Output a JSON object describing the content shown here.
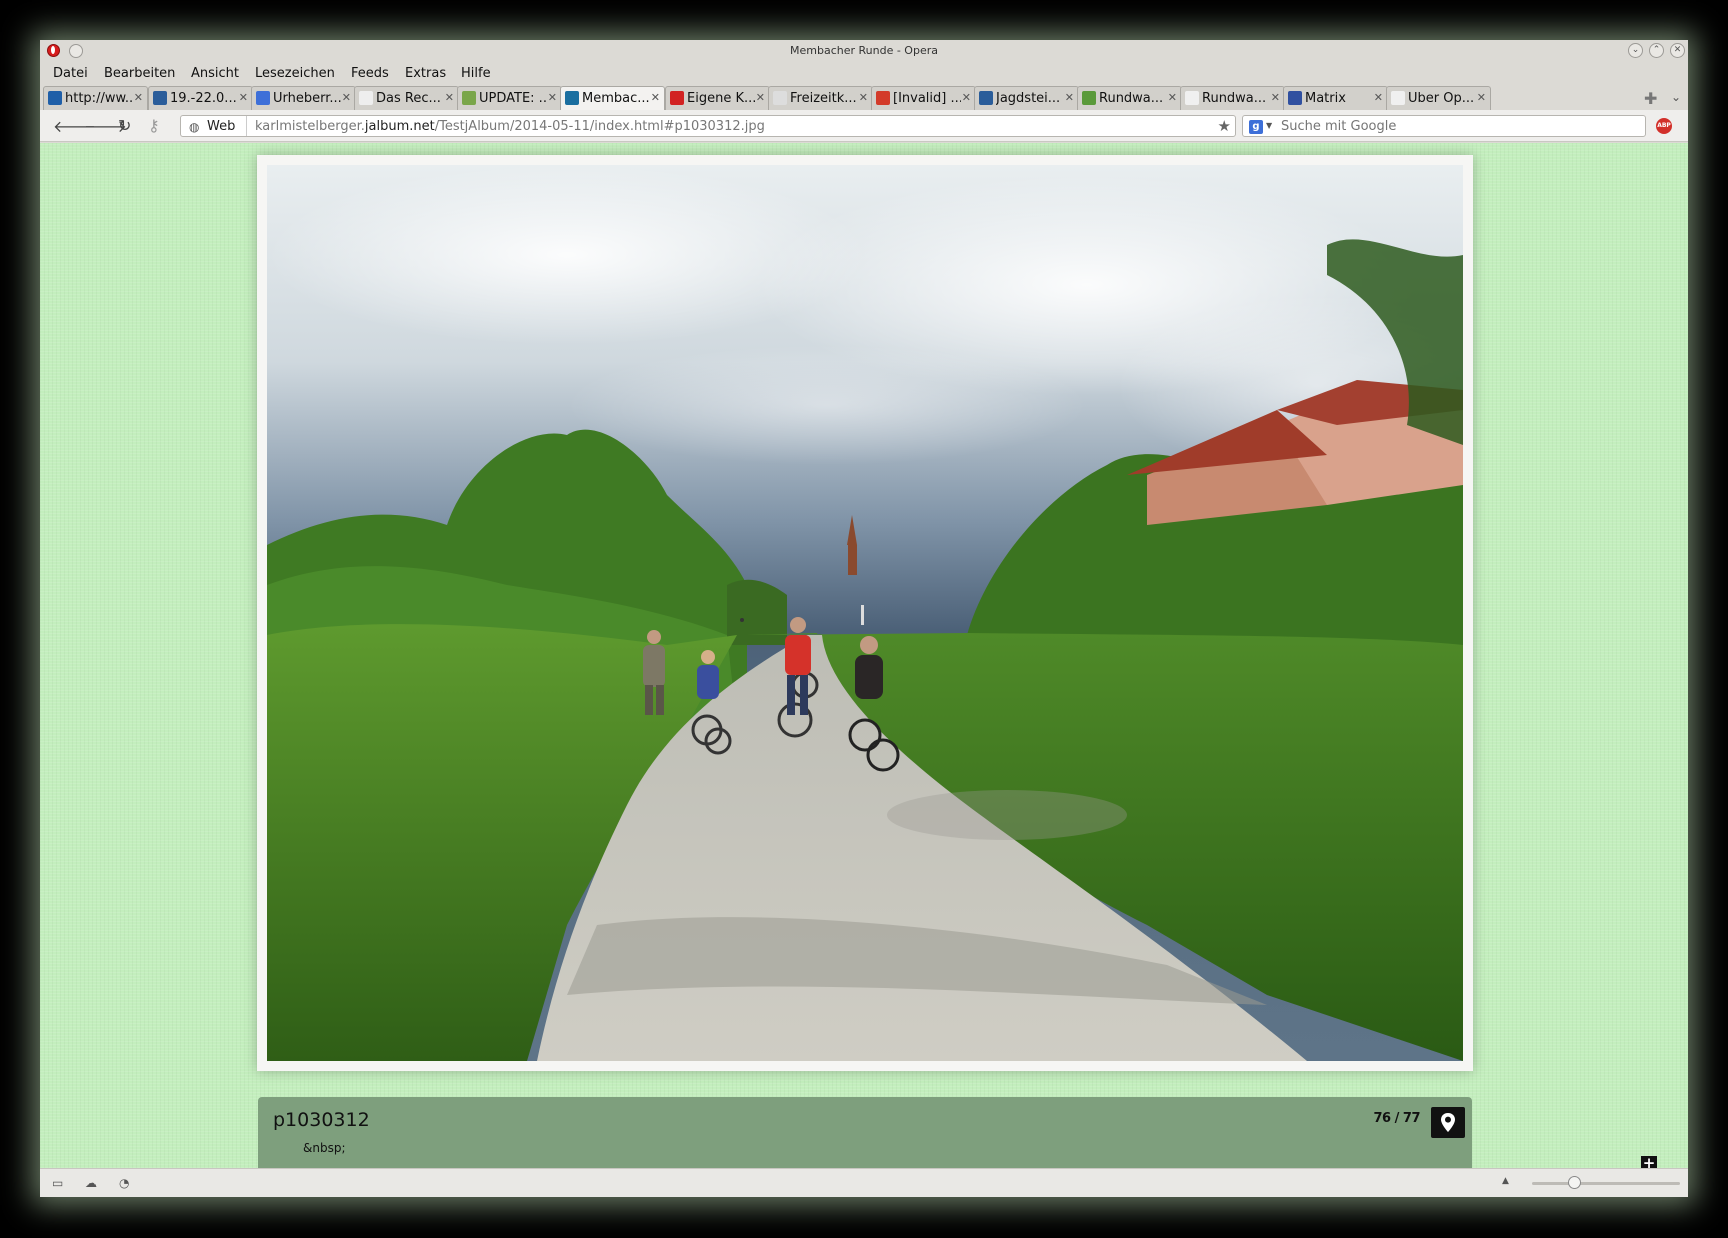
{
  "window": {
    "title": "Membacher Runde - Opera"
  },
  "menu": [
    "Datei",
    "Bearbeiten",
    "Ansicht",
    "Lesezeichen",
    "Feeds",
    "Extras",
    "Hilfe"
  ],
  "tabs": [
    {
      "label": "http://ww...",
      "color": "#1f5fa8"
    },
    {
      "label": "19.-22.0...",
      "color": "#2a5d9a"
    },
    {
      "label": "Urheberr...",
      "color": "#3d6fd8"
    },
    {
      "label": "Das Rec...",
      "color": "#eeeeee"
    },
    {
      "label": "UPDATE: ...",
      "color": "#7aa64a"
    },
    {
      "label": "Membac...",
      "color": "#1b6fa0"
    },
    {
      "label": "Eigene K...",
      "color": "#d22222"
    },
    {
      "label": "Freizeitk...",
      "color": "#dddddd"
    },
    {
      "label": "[Invalid] ...",
      "color": "#d33b2a"
    },
    {
      "label": "Jagdstei...",
      "color": "#2a5d9a"
    },
    {
      "label": "Rundwa...",
      "color": "#5a9a3a"
    },
    {
      "label": "Rundwa...",
      "color": "#f0f0f0"
    },
    {
      "label": "Matrix",
      "color": "#3050a0"
    },
    {
      "label": "Über Op...",
      "color": "#f0f0f0"
    }
  ],
  "navbar": {
    "web_label": "Web",
    "url_host_prefix": "karlmistelberger.",
    "url_host_main": "jalbum.net",
    "url_path": "/TestjAlbum/2014-05-11/index.html#p1030312.jpg",
    "search_placeholder": "Suche mit Google",
    "adblock_label": "ABP"
  },
  "caption": {
    "title": "p1030312",
    "description": "&nbsp;",
    "counter": "76 / 77"
  }
}
